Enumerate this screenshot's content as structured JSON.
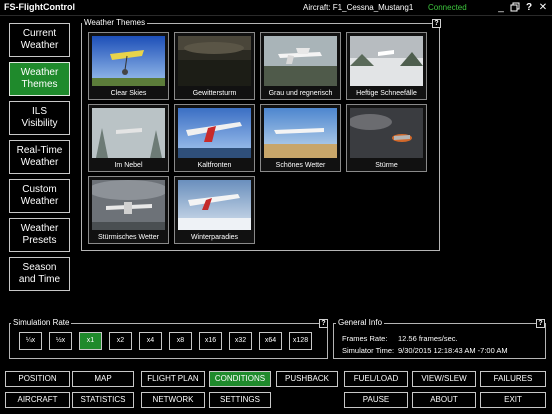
{
  "titlebar": {
    "app_title": "FS-FlightControl",
    "aircraft": "Aircraft:  F1_Cessna_Mustang1",
    "status": "Connected",
    "minimize": "_",
    "help": "?",
    "close": "✕"
  },
  "nav": {
    "items": [
      {
        "line1": "Current",
        "line2": "Weather"
      },
      {
        "line1": "Weather",
        "line2": "Themes"
      },
      {
        "line1": "ILS",
        "line2": "Visibility"
      },
      {
        "line1": "Real-Time",
        "line2": "Weather"
      },
      {
        "line1": "Custom",
        "line2": "Weather"
      },
      {
        "line1": "Weather",
        "line2": "Presets"
      },
      {
        "line1": "Season",
        "line2": "and Time"
      }
    ]
  },
  "themes": {
    "legend": "Weather Themes",
    "help": "?",
    "items": [
      {
        "label": "Clear Skies"
      },
      {
        "label": "Gewittersturm"
      },
      {
        "label": "Grau und regnerisch"
      },
      {
        "label": "Heftige Schneefälle"
      },
      {
        "label": "Im Nebel"
      },
      {
        "label": "Kaltfronten"
      },
      {
        "label": "Schönes Wetter"
      },
      {
        "label": "Stürme"
      },
      {
        "label": "Stürmisches Wetter"
      },
      {
        "label": "Winterparadies"
      }
    ]
  },
  "simrate": {
    "legend": "Simulation Rate",
    "help": "?",
    "buttons": [
      "¼x",
      "½x",
      "x1",
      "x2",
      "x4",
      "x8",
      "x16",
      "x32",
      "x64",
      "x128"
    ],
    "selected": "x1"
  },
  "info": {
    "legend": "General Info",
    "help": "?",
    "frames_label": "Frames Rate:",
    "frames_value": "12.56 frames/sec.",
    "time_label": "Simulator Time:",
    "time_value": "9/30/2015 12:18:43 AM -7:00 AM"
  },
  "bottom": {
    "row1": [
      "POSITION",
      "MAP",
      "FLIGHT PLAN",
      "CONDITIONS",
      "PUSHBACK",
      "FUEL/LOAD",
      "VIEW/SLEW",
      "FAILURES"
    ],
    "row2": [
      "AIRCRAFT",
      "STATISTICS",
      "NETWORK",
      "SETTINGS",
      "",
      "PAUSE",
      "ABOUT",
      "EXIT"
    ],
    "active": "CONDITIONS"
  },
  "colors": {
    "accent_green": "#1f8a2c",
    "connected_green": "#3ec83e"
  }
}
